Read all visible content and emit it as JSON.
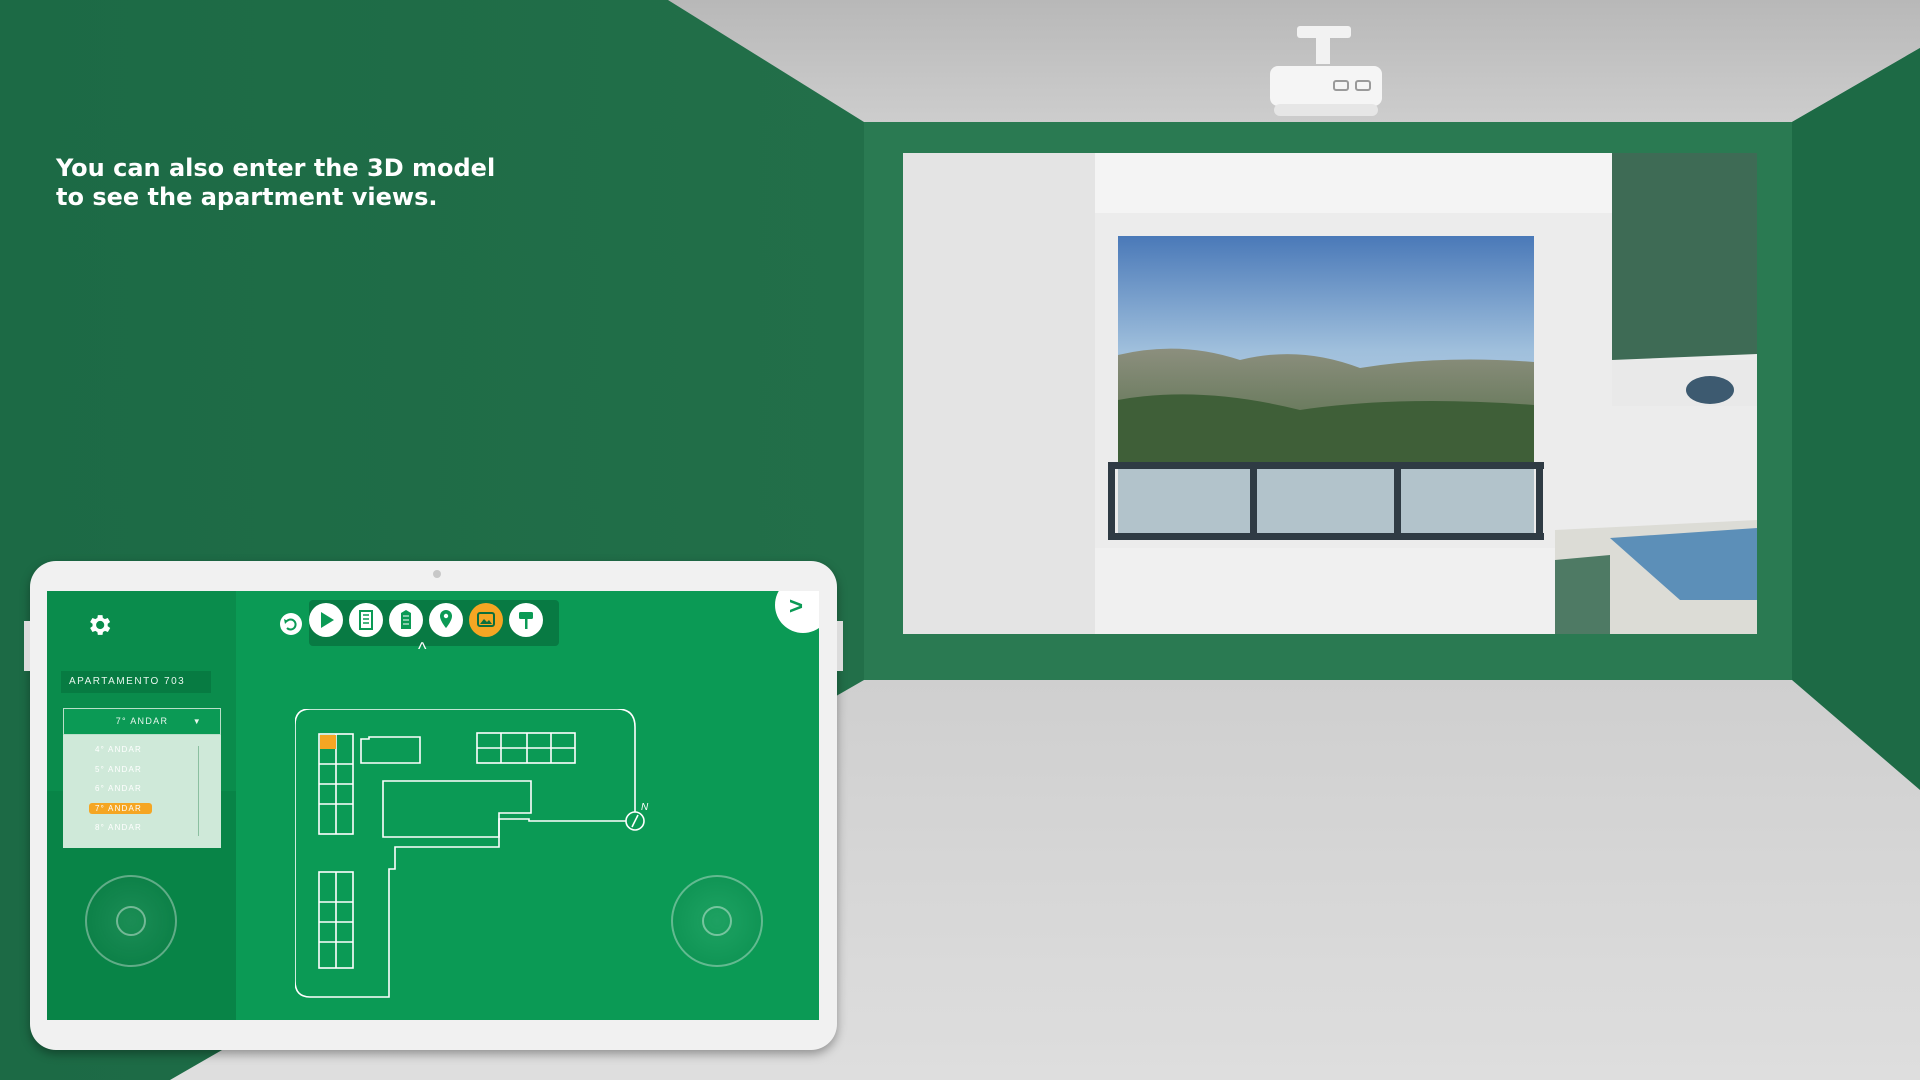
{
  "caption": {
    "line1": "You can also enter the 3D model",
    "line2": "to see the apartment views."
  },
  "colors": {
    "wall_green": "#1f6b47",
    "screen_green": "#0b9a55",
    "highlight": "#f5a623",
    "floor": "#d4d4d4"
  },
  "tablet": {
    "apartment_label": "APARTAMENTO 703",
    "floor_select": {
      "selected": "7° ANDAR",
      "arrow_icon": "▼",
      "options": [
        "4° ANDAR",
        "5° ANDAR",
        "6° ANDAR",
        "7° ANDAR",
        "8° ANDAR"
      ],
      "active_option": "7° ANDAR"
    },
    "toolbar_icons": [
      "undo-icon",
      "play-icon",
      "building-icon",
      "tower-icon",
      "location-pin-icon",
      "image-view-icon",
      "paint-roller-icon"
    ],
    "active_tool": "image-view-icon",
    "next_label": ">",
    "caret": "^",
    "compass_label": "N"
  }
}
